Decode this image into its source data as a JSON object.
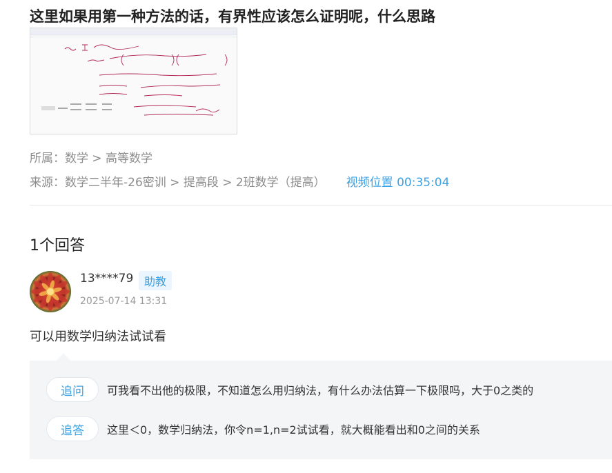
{
  "question": {
    "title": "这里如果用第一种方法的话，有界性应该怎么证明呢，什么思路"
  },
  "meta": {
    "category_label": "所属：",
    "category": "数学 > 高等数学",
    "source_label": "来源：",
    "source": "数学二半年-26密训 > 提高段 > 2班数学（提高）",
    "video_position": "视频位置 00:35:04"
  },
  "answers": {
    "count_label": "1个回答",
    "items": [
      {
        "username": "13****79",
        "role_badge": "助教",
        "time": "2025-07-14 13:31",
        "content": "可以用数学归纳法试试看",
        "followups": [
          {
            "tag": "追问",
            "text": "可我看不出他的极限，不知道怎么用归纳法，有什么办法估算一下极限吗，大于0之类的"
          },
          {
            "tag": "追答",
            "text": "这里＜0，数学归纳法，你令n=1,n=2试试看，就大概能看出和0之间的关系"
          }
        ]
      }
    ]
  },
  "colors": {
    "accent": "#3ba1e5",
    "muted": "#8c8c8c",
    "panel_bg": "#f3f5f7",
    "handwriting": "#b0285a"
  },
  "icons": {
    "avatar": "flower-avatar-image",
    "thumbnail": "math-screenshot-thumbnail"
  }
}
